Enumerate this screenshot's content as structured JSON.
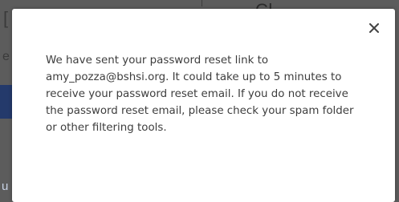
{
  "background": {
    "heading_fragment": "Cl",
    "bracket_fragment": "[",
    "letter_fragment": "e",
    "button_fragment": "u"
  },
  "modal": {
    "close_label": "×",
    "close_icon": "close-icon",
    "message": "We have sent your password reset link to amy_pozza@bshsi.org. It could take up to 5 minutes to receive your password reset email. If you do not receive the password reset email, please check your spam folder or other filtering tools."
  }
}
